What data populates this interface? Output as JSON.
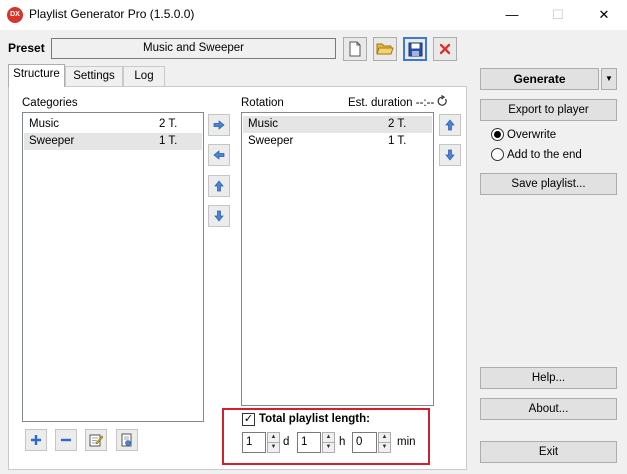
{
  "window": {
    "title": "Playlist Generator Pro (1.5.0.0)",
    "app_icon_text": "DX",
    "minimize_glyph": "—",
    "maximize_glyph": "☐",
    "close_glyph": "✕"
  },
  "preset": {
    "label": "Preset",
    "value": "Music and Sweeper"
  },
  "tabs": [
    {
      "label": "Structure"
    },
    {
      "label": "Settings"
    },
    {
      "label": "Log"
    }
  ],
  "categories": {
    "label": "Categories",
    "items": [
      {
        "name": "Music",
        "count": "2 T."
      },
      {
        "name": "Sweeper",
        "count": "1 T."
      }
    ]
  },
  "rotation": {
    "label": "Rotation",
    "est_duration_label": "Est. duration --:--",
    "items": [
      {
        "name": "Music",
        "count": "2 T."
      },
      {
        "name": "Sweeper",
        "count": "1 T."
      }
    ]
  },
  "total_length": {
    "label": "Total playlist length:",
    "checked": true,
    "days": "1",
    "days_unit": "d",
    "hours": "1",
    "hours_unit": "h",
    "minutes": "0",
    "minutes_unit": "min"
  },
  "sidebar": {
    "generate": "Generate",
    "export": "Export to player",
    "overwrite": "Overwrite",
    "add_to_end": "Add to the end",
    "save_playlist": "Save playlist...",
    "help": "Help...",
    "about": "About...",
    "exit": "Exit",
    "selected_mode": "overwrite"
  },
  "colors": {
    "accent_blue": "#3a7bd5",
    "highlight_red": "#d2202f",
    "folder_yellow": "#e8b93a",
    "delete_red": "#d9342b"
  }
}
